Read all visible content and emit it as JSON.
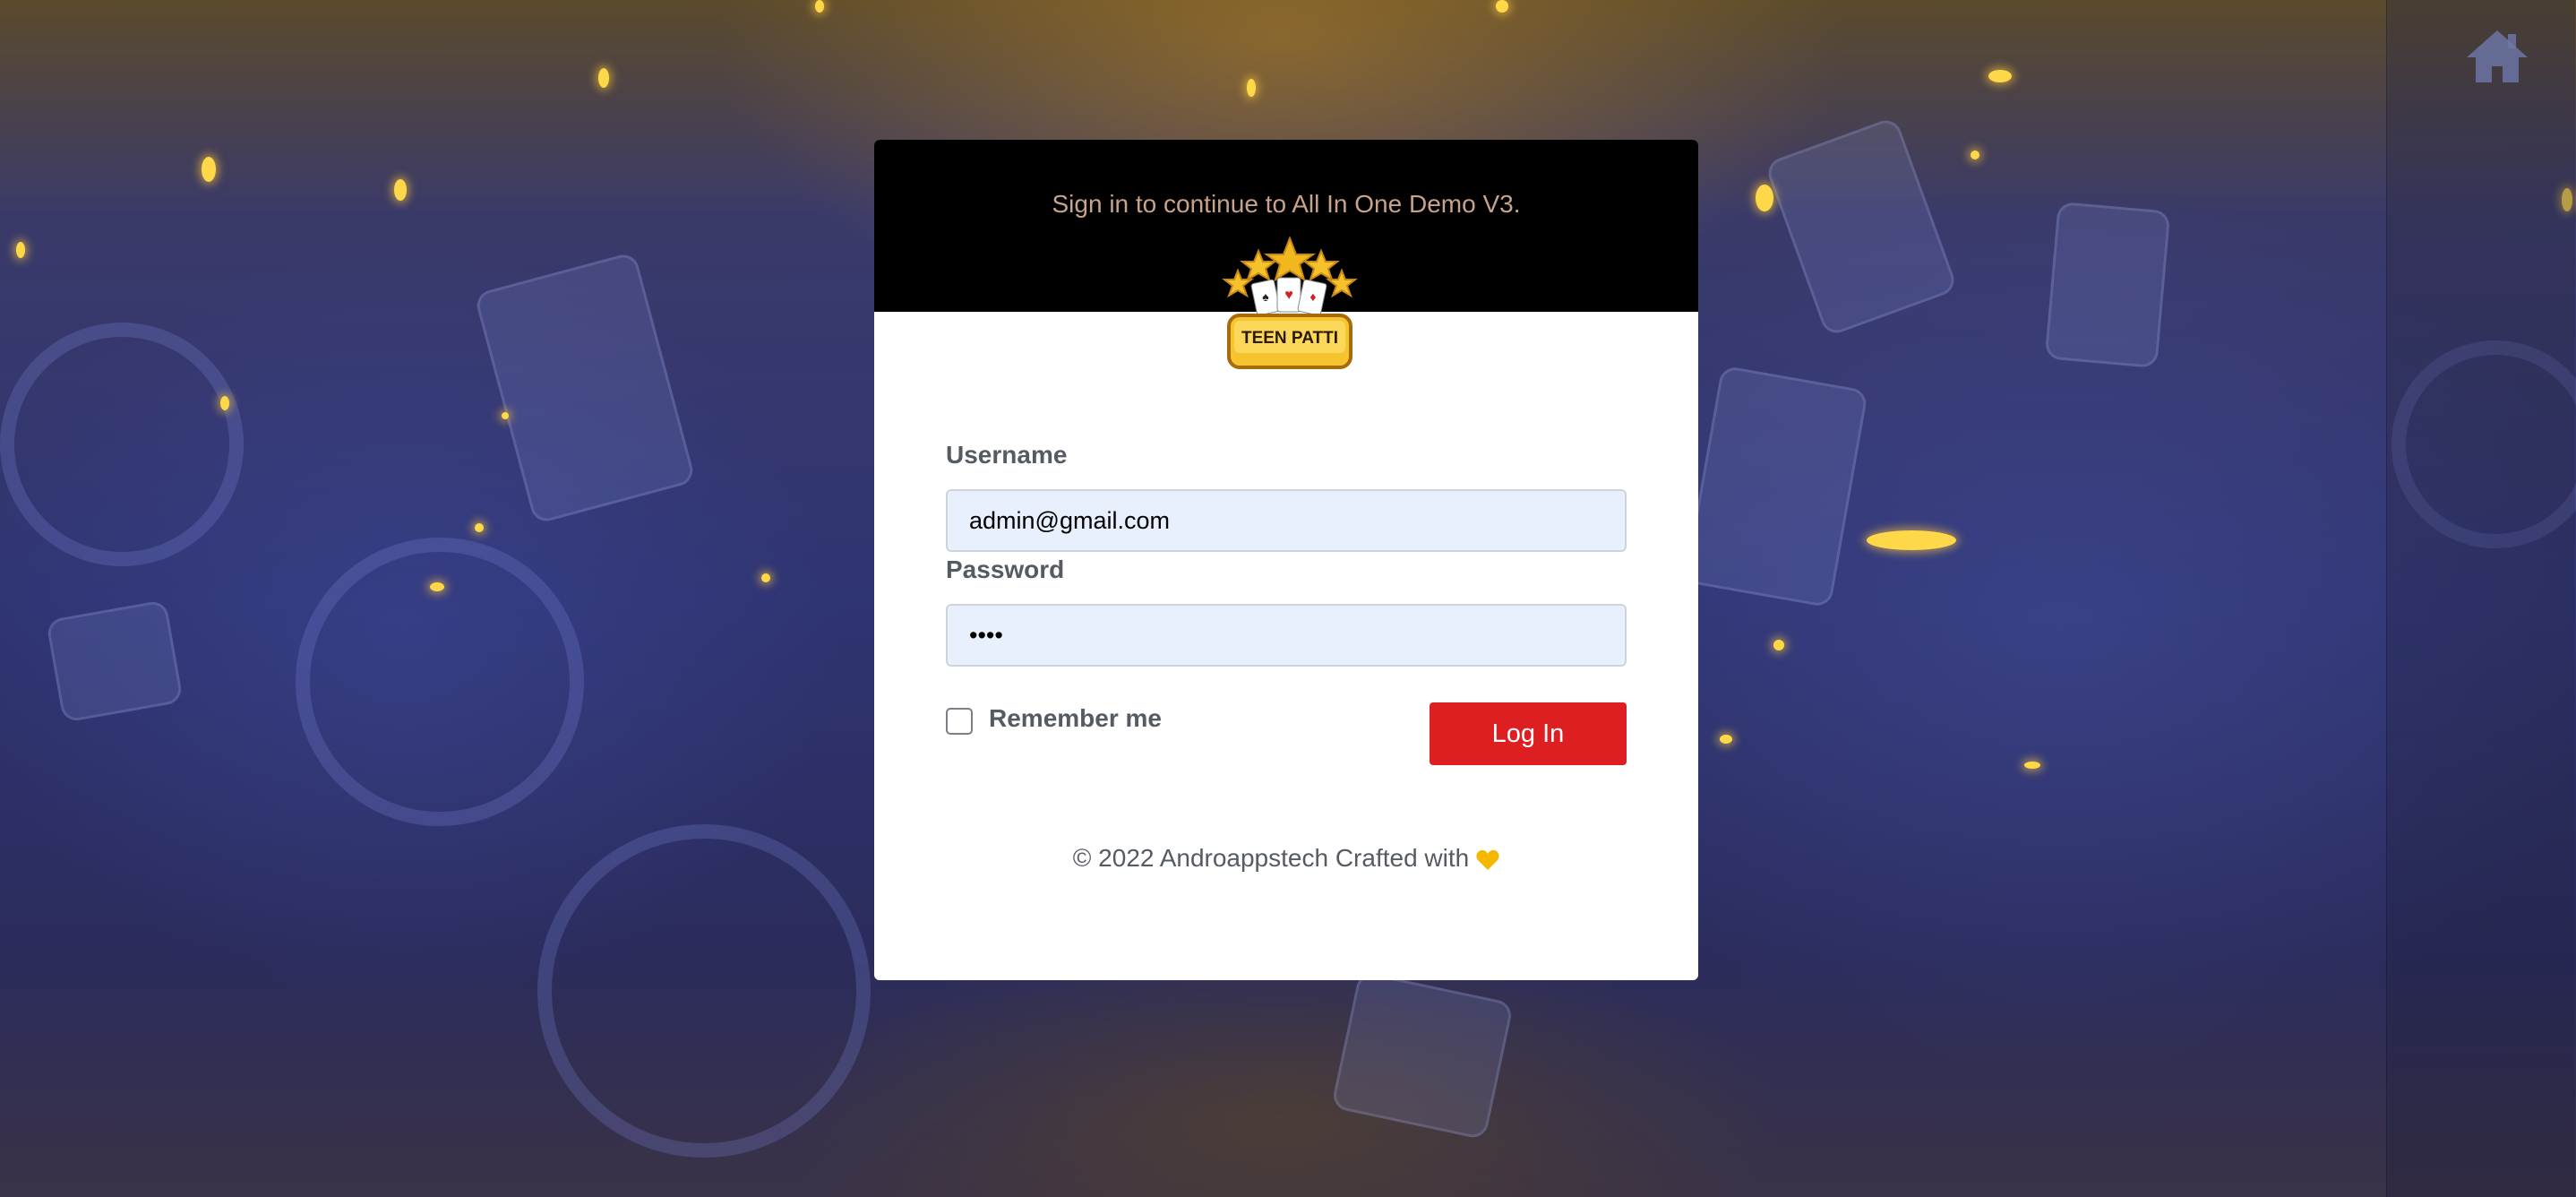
{
  "header": {
    "subtitle": "Sign in to continue to All In One Demo V3.",
    "logo_text": "TEEN PATTI"
  },
  "form": {
    "username_label": "Username",
    "username_value": "admin@gmail.com",
    "password_label": "Password",
    "password_value": "••••",
    "remember_label": "Remember me",
    "remember_checked": false,
    "login_label": "Log In"
  },
  "footer": {
    "text": "© 2022 Androappstech Crafted with"
  },
  "icons": {
    "home": "home-icon",
    "heart": "heart-icon"
  },
  "colors": {
    "accent_button": "#dd1f22",
    "input_background": "#e8f0fe",
    "header_background": "#000000",
    "heart": "#f5b800"
  }
}
